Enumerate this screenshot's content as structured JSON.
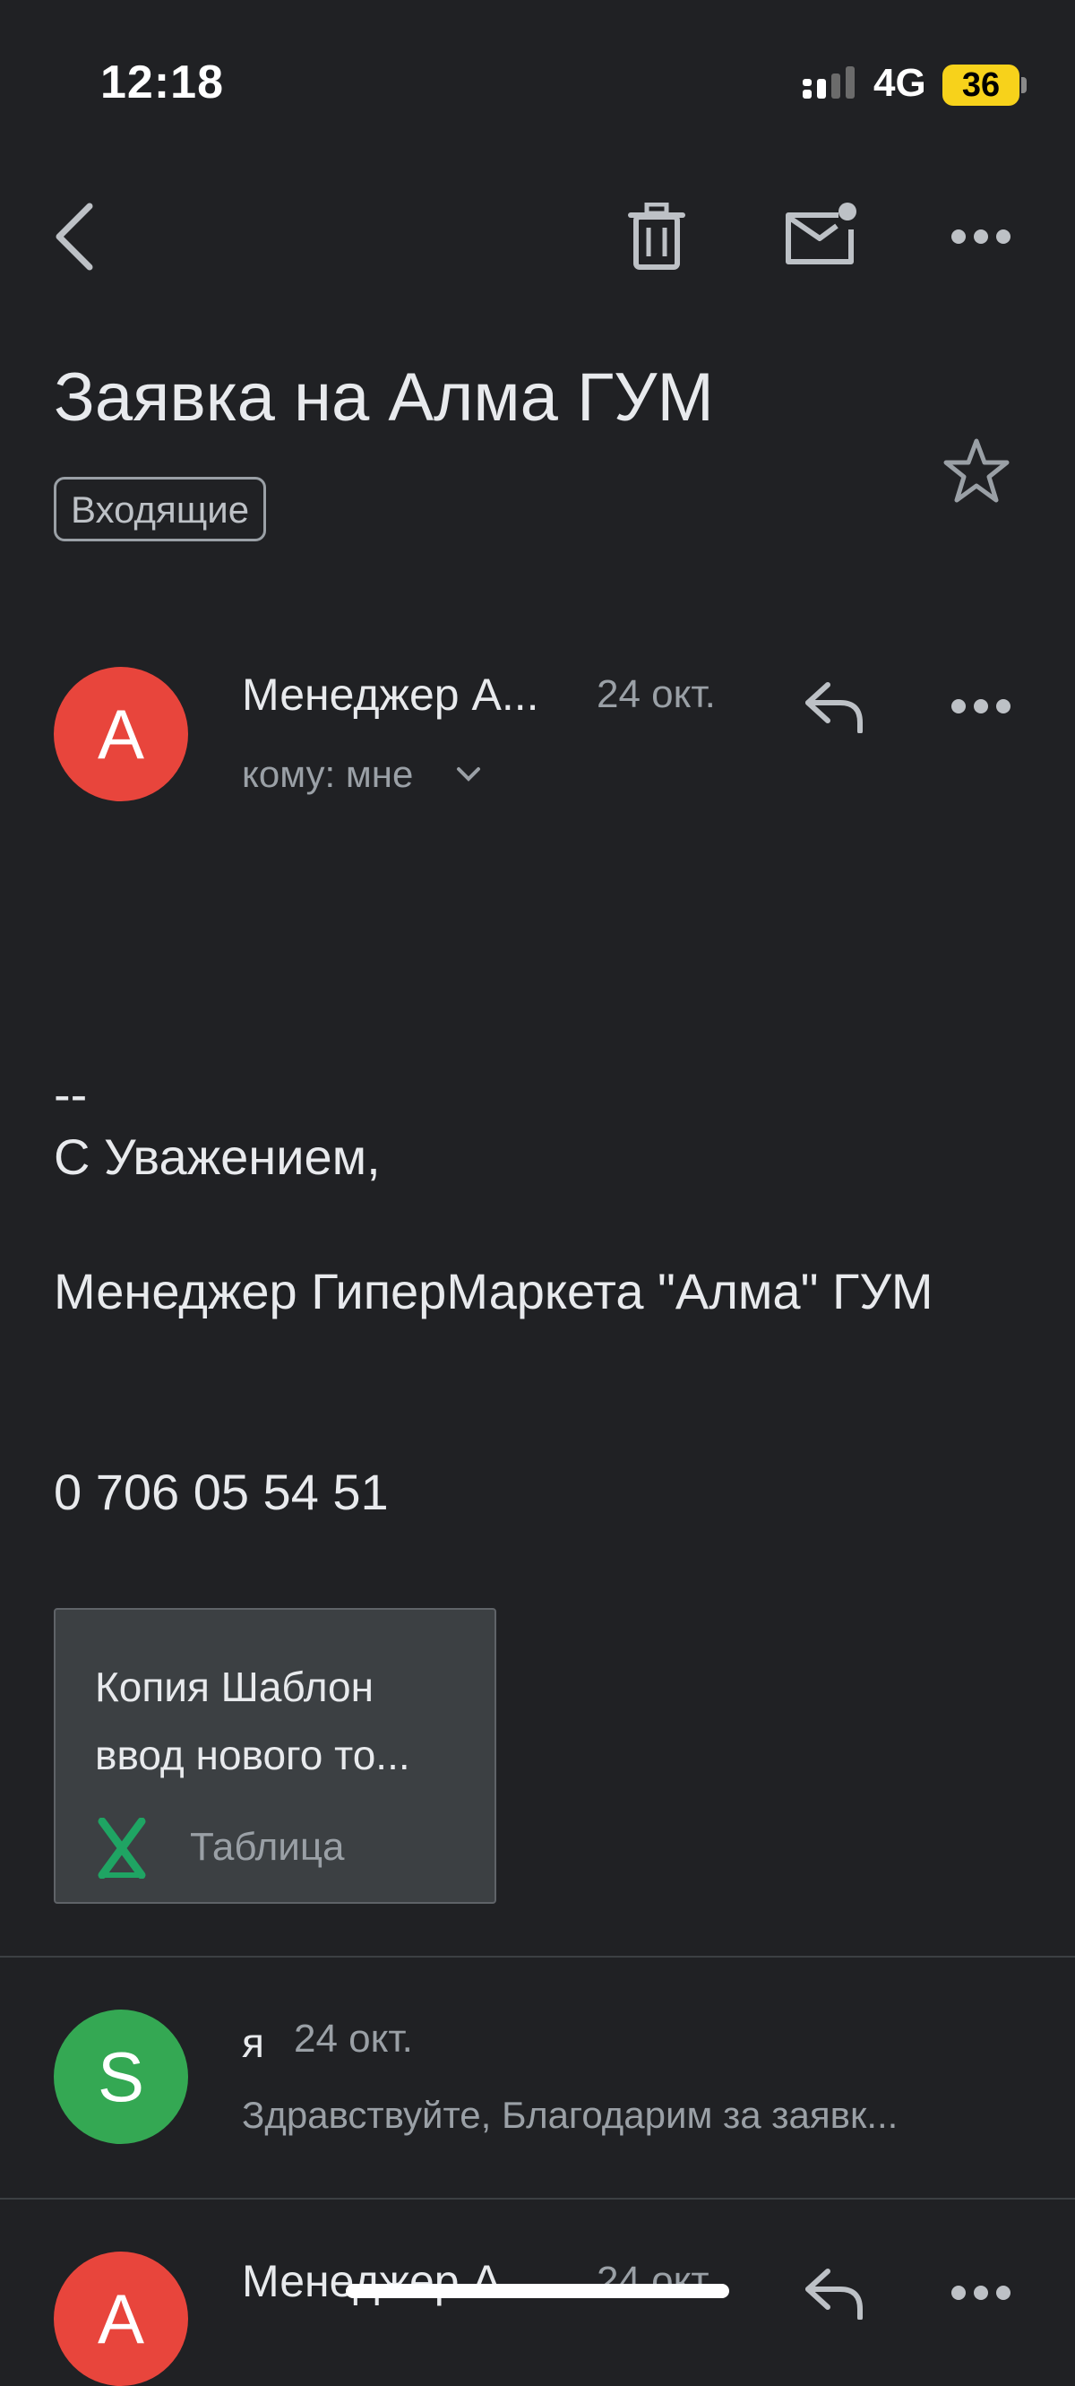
{
  "status_bar": {
    "time": "12:18",
    "network": "4G",
    "battery": "36"
  },
  "toolbar": {
    "back_icon": "chevron-left-icon",
    "delete_icon": "trash-icon",
    "mark_unread_icon": "mail-dot-icon",
    "more_icon": "more-horizontal-icon"
  },
  "email": {
    "subject": "Заявка на Алма ГУМ",
    "label": "Входящие",
    "message1": {
      "avatar_letter": "А",
      "sender": "Менеджер А...",
      "date": "24 окт.",
      "recipient": "кому: мне",
      "signature": {
        "dash": "--",
        "regards": "С Уважением,",
        "title": "Менеджер ГиперМаркета \"Алма\" ГУМ",
        "phone": "0 706 05 54 51"
      },
      "attachment": {
        "name": "Копия Шаблон ввод нового то...",
        "type": "Таблица"
      }
    },
    "message2": {
      "avatar_letter": "S",
      "sender": "я",
      "date": "24 окт.",
      "snippet": "Здравствуйте, Благодарим за заявк..."
    },
    "message3": {
      "avatar_letter": "А",
      "sender": "Менеджер А...",
      "date": "24 окт."
    }
  },
  "colors": {
    "background": "#202124",
    "avatar_red": "#e8453c",
    "avatar_green": "#34a853",
    "sheets_green": "#1fa463",
    "battery_yellow": "#f7d21b"
  }
}
